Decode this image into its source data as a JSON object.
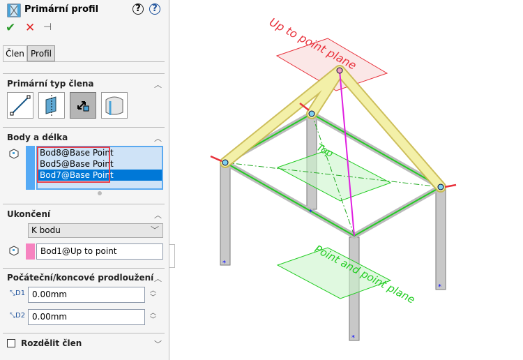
{
  "panel": {
    "title": "Primární profil",
    "icons": [
      "frame-icon",
      "help-whats-new-icon",
      "help-icon",
      "ok-icon",
      "cancel-icon",
      "pin-icon"
    ],
    "tabs": [
      {
        "label": "Člen",
        "active": true
      },
      {
        "label": "Profil",
        "active": false
      }
    ],
    "sections": {
      "member_type": {
        "title": "Primární typ člena",
        "buttons": [
          "line-member",
          "plane-member",
          "point-length-member",
          "cylinder-member"
        ],
        "selected": 2
      },
      "points": {
        "title": "Body a délka",
        "items": [
          "Bod8@Base Point",
          "Bod5@Base Point",
          "Bod7@Base Point"
        ],
        "selected_index": 2
      },
      "end": {
        "title": "Ukončení",
        "dropdown": "K bodu",
        "point": "Bod1@Up to point"
      },
      "extension": {
        "title": "Počáteční/koncové prodloužení",
        "d1": "0.00mm",
        "d2": "0.00mm"
      },
      "split": {
        "label": "Rozdělit člen",
        "checked": false
      }
    }
  },
  "viewport": {
    "labels": {
      "up_plane": "Up to point plane",
      "top": "Top",
      "point_plane": "Point and point plane"
    },
    "colors": {
      "red": "#e8303a",
      "green": "#22cc22",
      "magenta": "#e020e0",
      "member": "#f3f0a8"
    }
  }
}
